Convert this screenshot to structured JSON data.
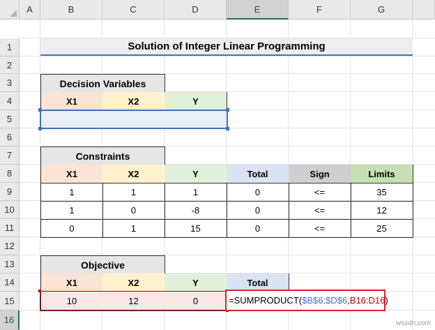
{
  "columns": [
    "A",
    "B",
    "C",
    "D",
    "E",
    "F",
    "G"
  ],
  "selected_column": "E",
  "rows": [
    "1",
    "2",
    "3",
    "4",
    "5",
    "6",
    "7",
    "8",
    "9",
    "10",
    "11",
    "12",
    "13",
    "14",
    "15",
    "16"
  ],
  "selected_row": "16",
  "title": "Solution of Integer Linear Programming",
  "decision": {
    "title": "Decision Variables",
    "headers": [
      "X1",
      "X2",
      "Y"
    ]
  },
  "constraints": {
    "title": "Constraints",
    "headers": [
      "X1",
      "X2",
      "Y",
      "Total",
      "Sign",
      "Limits"
    ],
    "rows": [
      [
        "1",
        "1",
        "1",
        "0",
        "<=",
        "35"
      ],
      [
        "1",
        "0",
        "-8",
        "0",
        "<=",
        "12"
      ],
      [
        "0",
        "1",
        "15",
        "0",
        "<=",
        "25"
      ]
    ]
  },
  "objective": {
    "title": "Objective",
    "headers": [
      "X1",
      "X2",
      "Y",
      "Total"
    ],
    "values": [
      "10",
      "12",
      "0"
    ]
  },
  "formula": {
    "prefix": "=SUMPRODUCT(",
    "ref1": "$B$6:$D$6",
    "sep": ",",
    "ref2": "B16:D16",
    "suffix": ")"
  },
  "colors": {
    "ref1": "#4472c4",
    "ref2": "#c00000",
    "active_border": "#e0202a",
    "title_underline": "#4472c4",
    "selection": "#3f6fc1"
  },
  "watermark": "wsxdn.com"
}
